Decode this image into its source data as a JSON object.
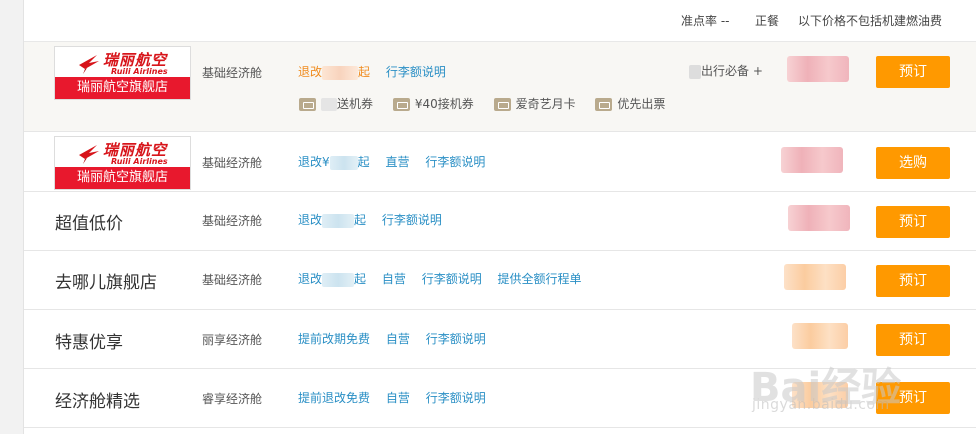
{
  "header": {
    "accuracy": "准点率 --",
    "meal": "正餐",
    "price_note": "以下价格不包括机建燃油费"
  },
  "colors": {
    "accent": "#ff9900",
    "link": "#2a8fc5",
    "orange_link": "#f08c1f",
    "logo_red": "#e8182d"
  },
  "rows": [
    {
      "logo": {
        "brand_cn": "瑞丽航空",
        "brand_en": "Ruili Airlines",
        "store": "瑞丽航空旗舰店"
      },
      "cabin": "基础经济舱",
      "links": {
        "change": "退改",
        "change_suffix": "起",
        "luggage": "行李额说明"
      },
      "travel_note": "出行必备 +",
      "perks": [
        "送机券",
        "¥40接机券",
        "爱奇艺月卡",
        "优先出票"
      ],
      "perk_icons": [
        "coupon-icon",
        "coupon-icon",
        "card-icon",
        "ticket-icon"
      ],
      "button": "预订"
    },
    {
      "logo": {
        "brand_cn": "瑞丽航空",
        "brand_en": "Ruili Airlines",
        "store": "瑞丽航空旗舰店"
      },
      "cabin": "基础经济舱",
      "links": {
        "change": "退改¥",
        "change_suffix": "起",
        "direct": "直营",
        "luggage": "行李额说明"
      },
      "button": "选购"
    },
    {
      "vendor": "超值低价",
      "cabin": "基础经济舱",
      "links": {
        "change": "退改",
        "change_suffix": "起",
        "luggage": "行李额说明"
      },
      "button": "预订"
    },
    {
      "vendor": "去哪儿旗舰店",
      "cabin": "基础经济舱",
      "links": {
        "change": "退改",
        "change_suffix": "起",
        "direct": "自营",
        "luggage": "行李额说明",
        "itinerary": "提供全额行程单"
      },
      "button": "预订"
    },
    {
      "vendor": "特惠优享",
      "cabin": "丽享经济舱",
      "links": {
        "change": "提前改期免费",
        "direct": "自营",
        "luggage": "行李额说明"
      },
      "button": "预订"
    },
    {
      "vendor": "经济舱精选",
      "cabin": "睿享经济舱",
      "links": {
        "change": "提前退改免费",
        "direct": "自营",
        "luggage": "行李额说明"
      },
      "button": "预订"
    }
  ],
  "watermark": {
    "brand": "Bai经验",
    "url": "jingyan.baidu.com"
  }
}
